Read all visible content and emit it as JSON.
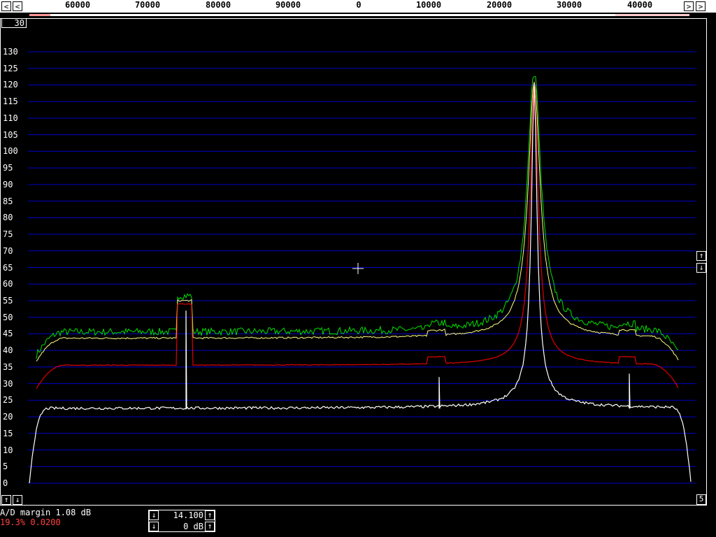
{
  "freq_scale": {
    "labels": [
      "60000",
      "70000",
      "80000",
      "90000",
      "0",
      "10000",
      "20000",
      "30000",
      "40000"
    ]
  },
  "nav": {
    "left_arrow": "<",
    "right_arrow": ">",
    "right_arrow2": ">",
    "left_arrow2": "<",
    "up_arrow": "↑",
    "down_arrow": "↓"
  },
  "badge": "30",
  "y_axis": {
    "labels": [
      "130",
      "125",
      "120",
      "115",
      "110",
      "105",
      "100",
      "95",
      "90",
      "85",
      "80",
      "75",
      "70",
      "65",
      "60",
      "55",
      "50",
      "45",
      "40",
      "35",
      "30",
      "25",
      "20",
      "15",
      "10",
      "5",
      "0"
    ]
  },
  "right_box": "5",
  "status": {
    "ad_margin": "A/D margin 1.08 dB",
    "percent": "19.3% 0.0200"
  },
  "control": {
    "value1": "14.100",
    "value2": "0 dB"
  },
  "colors": {
    "grid": "#0000c8",
    "green": "#00e000",
    "yellow": "#ffff80",
    "red": "#e00000",
    "white": "#ffffff"
  }
}
